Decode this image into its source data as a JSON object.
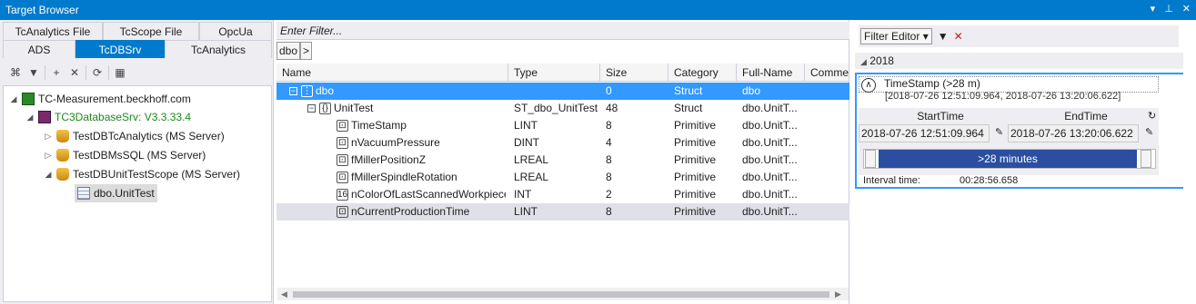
{
  "window": {
    "title": "Target Browser",
    "icons": [
      "▾",
      "📌",
      "✕"
    ]
  },
  "left": {
    "tabs_row1": [
      "TcAnalytics File",
      "TcScope File",
      "OpcUa"
    ],
    "tabs_row2": [
      "ADS",
      "TcDBSrv",
      "TcAnalytics"
    ],
    "selected_tab": "TcDBSrv",
    "tree": {
      "root": "TC-Measurement.beckhoff.com",
      "server": "TC3DatabaseSrv: V3.3.33.4",
      "db1": "TestDBTcAnalytics (MS Server)",
      "db2": "TestDBMsSQL (MS Server)",
      "db3": "TestDBUnitTestScope (MS Server)",
      "table": "dbo.UnitTest"
    }
  },
  "middle": {
    "filter_placeholder": "Enter Filter...",
    "breadcrumb": "dbo",
    "breadcrumb_arrow": ">",
    "columns": [
      "Name",
      "Type",
      "Size",
      "Category",
      "Full-Name",
      "Comme"
    ],
    "rows": [
      {
        "name": "dbo",
        "type": "",
        "size": "0",
        "category": "Struct",
        "fullname": "dbo"
      },
      {
        "name": "UnitTest",
        "type": "ST_dbo_UnitTest",
        "size": "48",
        "category": "Struct",
        "fullname": "dbo.UnitT..."
      },
      {
        "name": "TimeStamp",
        "type": "LINT",
        "size": "8",
        "category": "Primitive",
        "fullname": "dbo.UnitT..."
      },
      {
        "name": "nVacuumPressure",
        "type": "DINT",
        "size": "4",
        "category": "Primitive",
        "fullname": "dbo.UnitT..."
      },
      {
        "name": "fMillerPositionZ",
        "type": "LREAL",
        "size": "8",
        "category": "Primitive",
        "fullname": "dbo.UnitT..."
      },
      {
        "name": "fMillerSpindleRotation",
        "type": "LREAL",
        "size": "8",
        "category": "Primitive",
        "fullname": "dbo.UnitT..."
      },
      {
        "name": "nColorOfLastScannedWorkpiece",
        "type": "INT",
        "size": "2",
        "category": "Primitive",
        "fullname": "dbo.UnitT..."
      },
      {
        "name": "nCurrentProductionTime",
        "type": "LINT",
        "size": "8",
        "category": "Primitive",
        "fullname": "dbo.UnitT..."
      }
    ]
  },
  "right": {
    "filter_editor": "Filter Editor",
    "year": "2018",
    "ts_title": "TimeStamp (>28 m)",
    "ts_range": "[2018-07-26 12:51:09.964, 2018-07-26 13:20:06.622]",
    "start_label": "StartTime",
    "end_label": "EndTime",
    "start_value": "2018-07-26 12:51:09.964",
    "end_value": "2018-07-26 13:20:06.622",
    "slider_label": ">28 minutes",
    "interval_label": "Interval time:",
    "interval_value": "00:28:56.658"
  },
  "colors": {
    "accent": "#007acc",
    "selection": "#3399ff",
    "slider": "#2b4ea0"
  }
}
